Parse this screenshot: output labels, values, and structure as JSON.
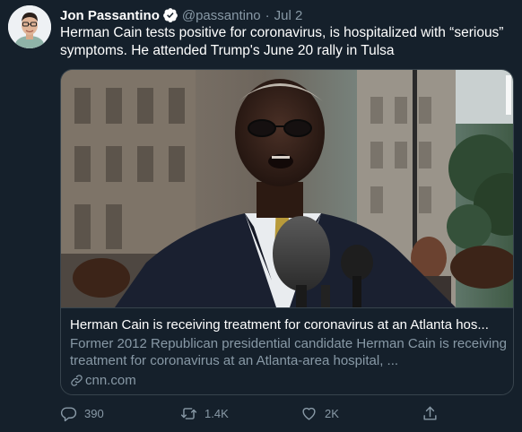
{
  "author": {
    "name": "Jon Passantino",
    "handle": "@passantino",
    "separator": "·",
    "date": "Jul 2"
  },
  "tweet": {
    "text": "Herman Cain tests positive for coronavirus, is hospitalized with “serious” symptoms. He attended Trump's June 20 rally in Tulsa"
  },
  "card": {
    "title": "Herman Cain is receiving treatment for coronavirus at an Atlanta hos...",
    "description": "Former 2012 Republican presidential candidate Herman Cain is receiving treatment for coronavirus at an Atlanta-area hospital, ...",
    "domain": "cnn.com"
  },
  "actions": {
    "reply_count": "390",
    "retweet_count": "1.4K",
    "like_count": "2K"
  },
  "icons": {
    "verified": "verified-badge-icon",
    "link": "link-icon",
    "reply": "reply-icon",
    "retweet": "retweet-icon",
    "like": "heart-icon",
    "share": "share-icon"
  },
  "colors": {
    "background": "#15202b",
    "secondary_text": "#8899a6",
    "border": "#38444d",
    "verified": "#ffffff"
  }
}
